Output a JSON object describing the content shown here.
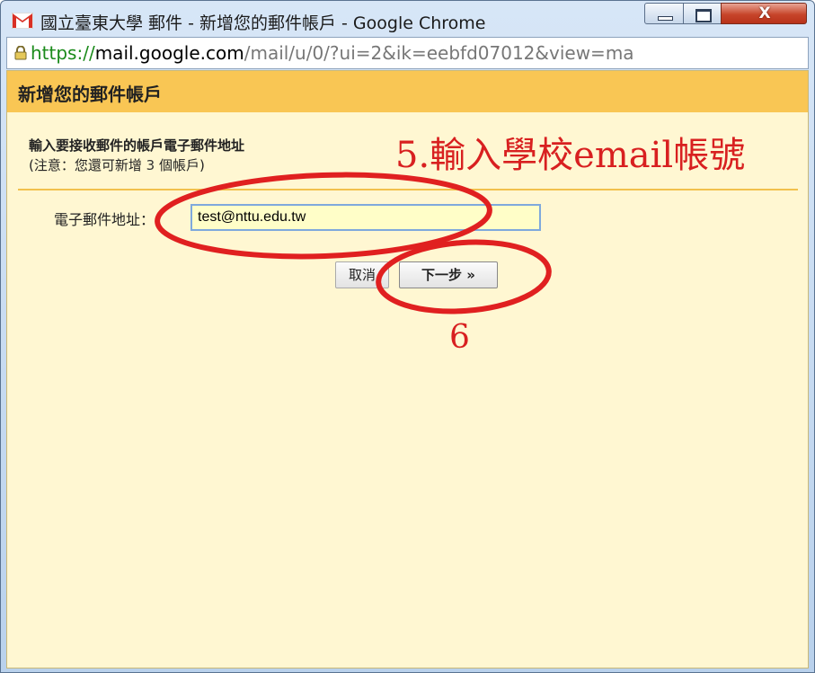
{
  "window": {
    "title": "國立臺東大學 郵件 - 新增您的郵件帳戶 - Google Chrome",
    "buttons": {
      "minimize": "minimize",
      "maximize": "maximize",
      "close": "X"
    }
  },
  "address_bar": {
    "scheme": "https://",
    "host": "mail.google.com",
    "path": "/mail/u/0/?ui=2&ik=eebfd07012&view=ma"
  },
  "dialog": {
    "title": "新增您的郵件帳戶",
    "instruction": "輸入要接收郵件的帳戶電子郵件地址",
    "note_prefix": "(注意：您還可新增 ",
    "note_count": "3",
    "note_suffix": " 個帳戶)",
    "email_label": "電子郵件地址：",
    "email_value": "test@nttu.edu.tw",
    "cancel_label": "取消",
    "next_label": "下一步 »"
  },
  "annotations": {
    "step5": "5.輸入學校email帳號",
    "step6": "6",
    "color": "#d82020"
  },
  "colors": {
    "header_bg": "#f9c654",
    "dialog_bg": "#fff7d2",
    "input_bg": "#fffec8"
  }
}
